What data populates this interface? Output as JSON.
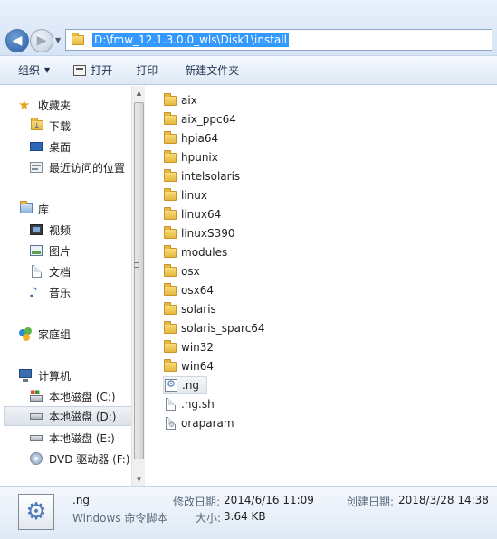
{
  "address": {
    "path": "D:\\fmw_12.1.3.0.0_wls\\Disk1\\install"
  },
  "toolbar": {
    "organize": "组织",
    "open": "打开",
    "print": "打印",
    "new_folder": "新建文件夹"
  },
  "nav": {
    "favorites": "收藏夹",
    "downloads": "下载",
    "desktop": "桌面",
    "recent": "最近访问的位置",
    "libraries": "库",
    "videos": "视频",
    "pictures": "图片",
    "documents": "文档",
    "music": "音乐",
    "homegroup": "家庭组",
    "computer": "计算机",
    "drive_c": "本地磁盘 (C:)",
    "drive_d": "本地磁盘 (D:)",
    "drive_e": "本地磁盘 (E:)",
    "drive_f": "DVD 驱动器 (F:)"
  },
  "files": [
    {
      "name": "aix",
      "type": "folder"
    },
    {
      "name": "aix_ppc64",
      "type": "folder"
    },
    {
      "name": "hpia64",
      "type": "folder"
    },
    {
      "name": "hpunix",
      "type": "folder"
    },
    {
      "name": "intelsolaris",
      "type": "folder"
    },
    {
      "name": "linux",
      "type": "folder"
    },
    {
      "name": "linux64",
      "type": "folder"
    },
    {
      "name": "linuxS390",
      "type": "folder"
    },
    {
      "name": "modules",
      "type": "folder"
    },
    {
      "name": "osx",
      "type": "folder"
    },
    {
      "name": "osx64",
      "type": "folder"
    },
    {
      "name": "solaris",
      "type": "folder"
    },
    {
      "name": "solaris_sparc64",
      "type": "folder"
    },
    {
      "name": "win32",
      "type": "folder"
    },
    {
      "name": "win64",
      "type": "folder"
    },
    {
      "name": ".ng",
      "type": "script"
    },
    {
      "name": ".ng.sh",
      "type": "file"
    },
    {
      "name": "oraparam",
      "type": "config"
    }
  ],
  "details": {
    "name": ".ng",
    "type": "Windows 命令脚本",
    "modified_label": "修改日期:",
    "modified_value": "2014/6/16 11:09",
    "size_label": "大小:",
    "size_value": "3.64 KB",
    "created_label": "创建日期:",
    "created_value": "2018/3/28 14:38"
  }
}
